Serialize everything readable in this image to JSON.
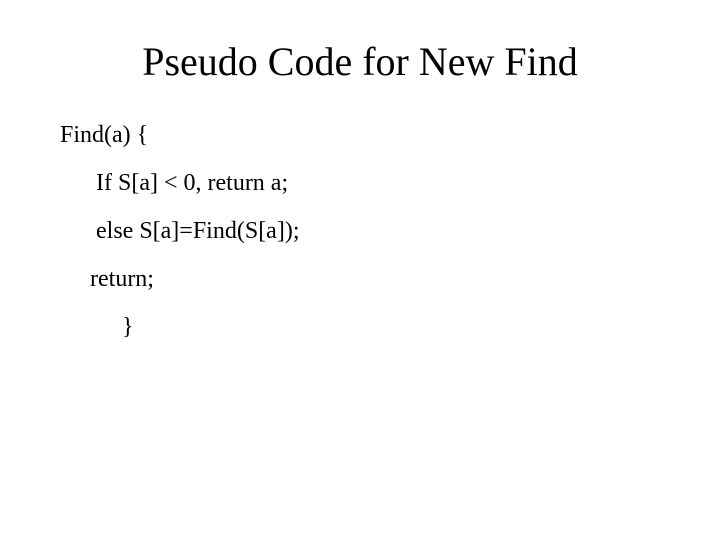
{
  "title": "Pseudo Code for New Find",
  "code": {
    "l1": "Find(a) {",
    "l2": "If S[a] < 0, return a;",
    "l3": "else S[a]=Find(S[a]);",
    "l4": "return;",
    "l5": "}"
  }
}
